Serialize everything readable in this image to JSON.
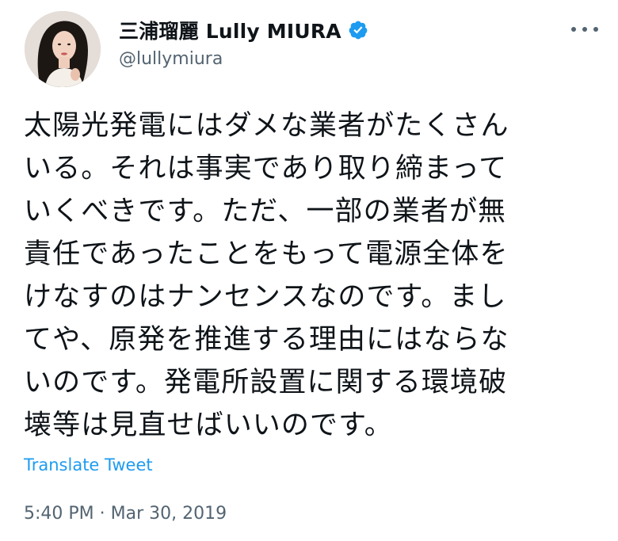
{
  "author": {
    "display_name": "三浦瑠麗 Lully MIURA",
    "handle": "@lullymiura",
    "verified": true
  },
  "tweet": {
    "lines": [
      "太陽光発電にはダメな業者がたくさん",
      "いる。それは事実であり取り締まって",
      "いくべきです。ただ、一部の業者が無",
      "責任であったことをもって電源全体を",
      "けなすのはナンセンスなのです。まし",
      "てや、原発を推進する理由にはならな",
      "いのです。発電所設置に関する環境破",
      "壊等は見直せばいいのです。"
    ],
    "translate_label": "Translate Tweet",
    "timestamp": "5:40 PM · Mar 30, 2019"
  },
  "icons": {
    "verified": "verified-badge-icon",
    "more": "more-options-icon"
  },
  "colors": {
    "accent": "#1d9bf0",
    "text_primary": "#0f1419",
    "text_secondary": "#536471"
  }
}
